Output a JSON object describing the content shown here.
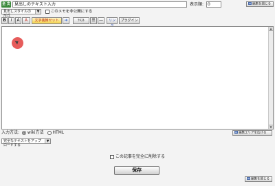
{
  "header": {
    "badge": "全 文",
    "title_value": "見出しのテキスト入力",
    "order_label": "表示順:",
    "order_value": "0",
    "collapse_label": "編集を閉じる"
  },
  "options": {
    "style_select": "見出しスタイルの形式",
    "public_checkbox_label": "このメモを非公開にする"
  },
  "toolbar": {
    "bold": "B",
    "italic": "I",
    "font_size": "A",
    "font_color": "A",
    "text_decoration": "文字装飾セット",
    "arrow": "➔",
    "text_box": "ﾃｷｽﾄ",
    "list": "☰",
    "hr": "—",
    "link": "リンク",
    "plugin": "プラグイン"
  },
  "mode": {
    "label": "入力方法:",
    "wiki_label": "wiki方法",
    "html_label": "HTML",
    "wiki_selected": true,
    "expand_label": "編集エリアを広げる"
  },
  "complete_select": "完全なテキストをアップロードする",
  "delete_checkbox_label": "この記事を完全に削除する",
  "save_label": "保存",
  "footer_collapse_label": "編集を閉じる"
}
